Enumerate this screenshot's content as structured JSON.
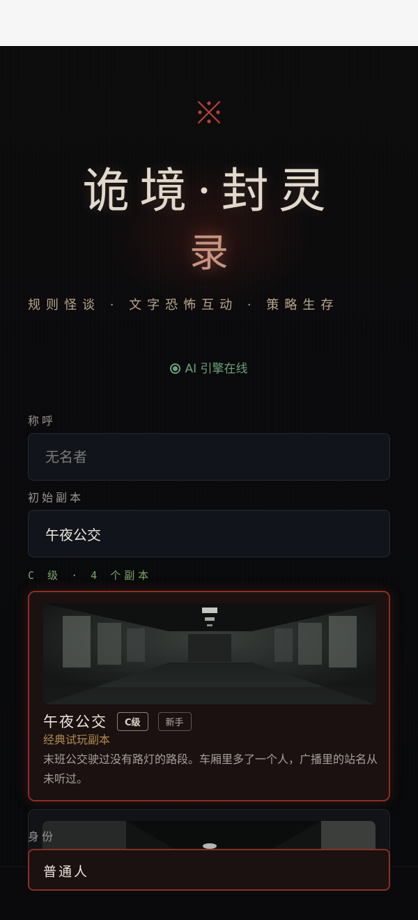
{
  "header": {
    "title_line1": "诡境·封灵",
    "title_line2": "录",
    "subtitle": "规则怪谈 · 文字恐怖互动 · 策略生存",
    "ai_status": "AI 引擎在线",
    "sigil_icon": "ornament-x-icon"
  },
  "form": {
    "name_label": "称呼",
    "name_placeholder": "无名者",
    "dungeon_label": "初始副本",
    "dungeon_value": "午夜公交",
    "dungeon_count": "C 级 · 4 个副本",
    "identity_label": "身份",
    "identity_value": "普通人"
  },
  "dungeons": [
    {
      "name": "午夜公交",
      "grade": "C级",
      "difficulty": "新手",
      "tag": "经典试玩副本",
      "description": "末班公交驶过没有路灯的路段。车厢里多了一个人，广播里的站名从未听过。"
    }
  ],
  "colors": {
    "accent_red": "#8a2f24",
    "ai_green": "#6aa37a",
    "tag_gold": "#b08a4e"
  }
}
